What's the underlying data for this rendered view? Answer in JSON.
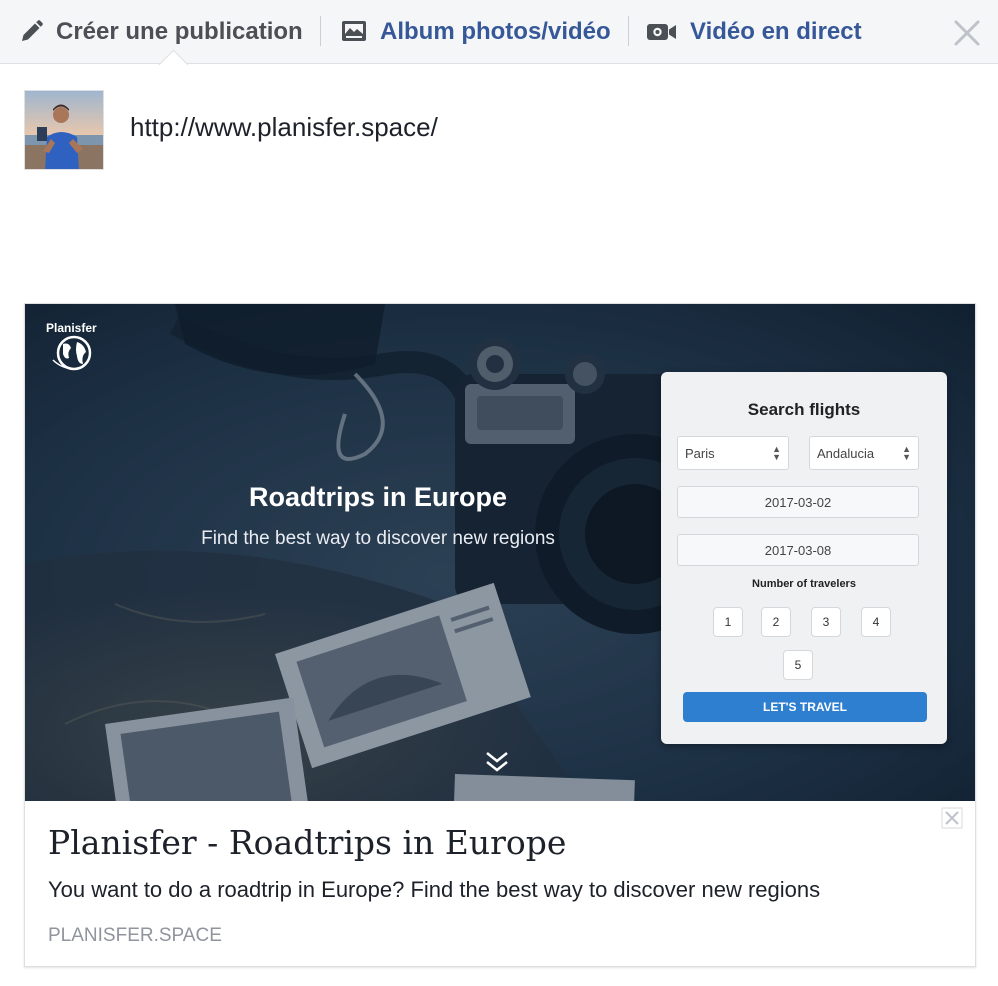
{
  "tabs": {
    "create": {
      "label": "Créer une publication",
      "icon": "pencil-icon"
    },
    "album": {
      "label": "Album photos/vidéo",
      "icon": "photo-icon"
    },
    "live": {
      "label": "Vidéo en direct",
      "icon": "video-camera-icon"
    },
    "close_icon": "close-icon"
  },
  "composer": {
    "text": "http://www.planisfer.space/"
  },
  "preview": {
    "hero": {
      "brand": "Planisfer",
      "title": "Roadtrips in Europe",
      "subtitle": "Find the best way to discover new regions",
      "search": {
        "title": "Search flights",
        "from": "Paris",
        "to": "Andalucia",
        "date_out": "2017-03-02",
        "date_back": "2017-03-08",
        "travelers_label": "Number of travelers",
        "travelers": [
          "1",
          "2",
          "3",
          "4",
          "5"
        ],
        "button": "LET'S TRAVEL"
      }
    },
    "title": "Planisfer - Roadtrips in Europe",
    "description": "You want to do a roadtrip in Europe? Find the best way to discover new regions",
    "domain": "PLANISFER.SPACE"
  },
  "colors": {
    "link_blue": "#365899",
    "tab_gray": "#4b4f56",
    "button_blue": "#2f7fd0",
    "domain_gray": "#90949c"
  }
}
